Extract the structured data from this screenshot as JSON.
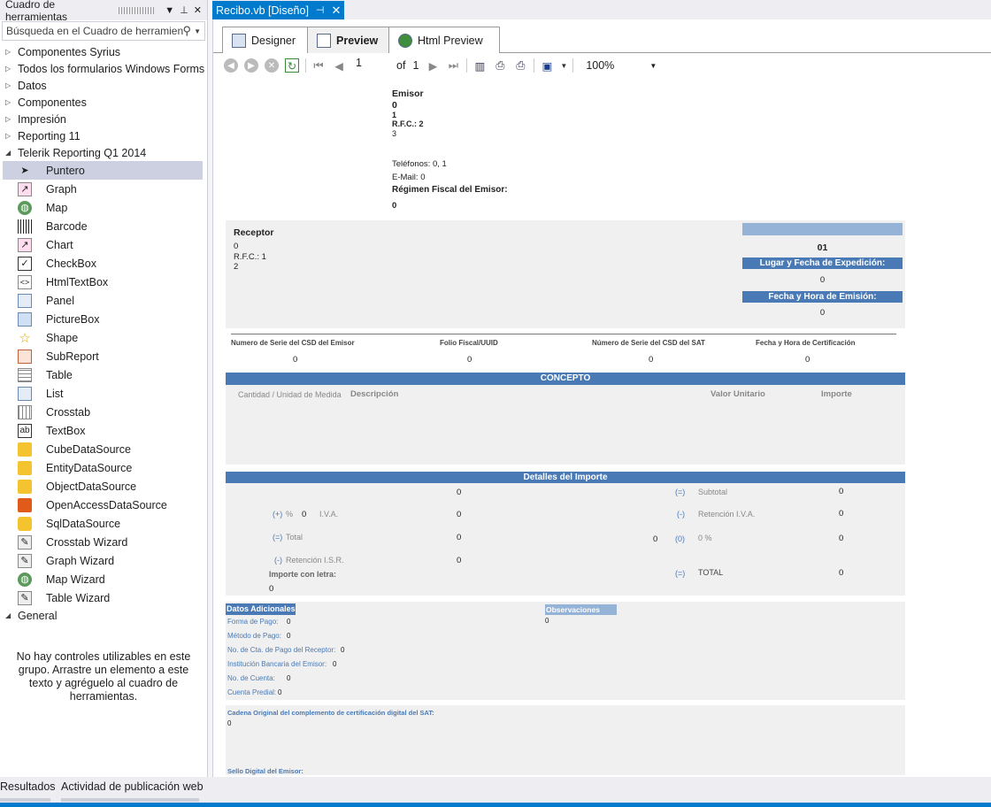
{
  "toolbox": {
    "title": "Cuadro de herramientas",
    "search_placeholder": "Búsqueda en el Cuadro de herramientas",
    "categories": [
      {
        "label": "Componentes Syrius"
      },
      {
        "label": "Todos los formularios Windows Forms"
      },
      {
        "label": "Datos"
      },
      {
        "label": "Componentes"
      },
      {
        "label": "Impresión"
      },
      {
        "label": "Reporting 11"
      },
      {
        "label": "Telerik Reporting Q1 2014"
      }
    ],
    "items": [
      {
        "label": "Puntero",
        "icon": "pointer-icon"
      },
      {
        "label": "Graph",
        "icon": "graph-icon"
      },
      {
        "label": "Map",
        "icon": "map-icon"
      },
      {
        "label": "Barcode",
        "icon": "barcode-icon"
      },
      {
        "label": "Chart",
        "icon": "chart-icon"
      },
      {
        "label": "CheckBox",
        "icon": "checkbox-icon"
      },
      {
        "label": "HtmlTextBox",
        "icon": "htmltextbox-icon"
      },
      {
        "label": "Panel",
        "icon": "panel-icon"
      },
      {
        "label": "PictureBox",
        "icon": "picturebox-icon"
      },
      {
        "label": "Shape",
        "icon": "shape-icon"
      },
      {
        "label": "SubReport",
        "icon": "subreport-icon"
      },
      {
        "label": "Table",
        "icon": "table-icon"
      },
      {
        "label": "List",
        "icon": "list-icon"
      },
      {
        "label": "Crosstab",
        "icon": "crosstab-icon"
      },
      {
        "label": "TextBox",
        "icon": "textbox-icon"
      },
      {
        "label": "CubeDataSource",
        "icon": "cube-datasource-icon"
      },
      {
        "label": "EntityDataSource",
        "icon": "entity-datasource-icon"
      },
      {
        "label": "ObjectDataSource",
        "icon": "object-datasource-icon"
      },
      {
        "label": "OpenAccessDataSource",
        "icon": "openaccess-datasource-icon"
      },
      {
        "label": "SqlDataSource",
        "icon": "sql-datasource-icon"
      },
      {
        "label": "Crosstab Wizard",
        "icon": "crosstab-wizard-icon"
      },
      {
        "label": "Graph Wizard",
        "icon": "graph-wizard-icon"
      },
      {
        "label": "Map Wizard",
        "icon": "map-wizard-icon"
      },
      {
        "label": "Table Wizard",
        "icon": "table-wizard-icon"
      }
    ],
    "general_label": "General",
    "empty_message": "No hay controles utilizables en este grupo. Arrastre un elemento a este texto y agréguelo al cuadro de herramientas."
  },
  "document": {
    "tab_title": "Recibo.vb [Diseño]",
    "view_tabs": [
      "Designer",
      "Preview",
      "Html Preview"
    ],
    "page_number": "1",
    "of_label": "of",
    "total_pages": "1",
    "zoom": "100%"
  },
  "report": {
    "emisor": {
      "title": "Emisor",
      "name": "0",
      "line1": "1",
      "rfc": "R.F.C.: 2",
      "line3": "3",
      "phones": "Teléfonos: 0, 1",
      "email": "E-Mail: 0",
      "regimen_label": "Régimen Fiscal del Emisor:",
      "regimen_value": "0"
    },
    "receptor": {
      "title": "Receptor",
      "name": "0",
      "rfc": "R.F.C.: 1",
      "line2": "2"
    },
    "right_box": {
      "folio": "01",
      "lugar_label": "Lugar y Fecha de Expedición:",
      "lugar_value": "0",
      "fecha_label": "Fecha y Hora de Emisión:",
      "fecha_value": "0"
    },
    "cert": {
      "headers": [
        "Numero de Serie del CSD del Emisor",
        "Folio Fiscal/UUID",
        "Número de Serie del CSD del SAT",
        "Fecha y Hora de Certificación"
      ],
      "values": [
        "0",
        "0",
        "0",
        "0"
      ]
    },
    "concepto": {
      "title": "CONCEPTO",
      "columns": [
        "Cantidad / Unidad de Medida",
        "Descripción",
        "Valor Unitario",
        "Importe"
      ]
    },
    "detalles": {
      "title": "Detalles del Importe",
      "top_value": "0",
      "iva_prefix": "(+)",
      "iva_pct_sign": "%",
      "iva_pct": "0",
      "iva_label": "I.V.A.",
      "iva_value": "0",
      "total_prefix": "(=)",
      "total_label": "Total",
      "total_value": "0",
      "ret_isr_prefix": "(-)",
      "ret_isr_label": "Retención I.S.R.",
      "ret_isr_value": "0",
      "importe_letra_label": "Importe con letra:",
      "importe_letra_value": "0",
      "subtotal_prefix": "(=)",
      "subtotal_label": "Subtotal",
      "subtotal_value": "0",
      "ret_iva_prefix": "(-)",
      "ret_iva_label": "Retención I.V.A.",
      "ret_iva_value": "0",
      "mid_value": "0",
      "pct_prefix": "(0)",
      "pct_label": "0 %",
      "pct_value": "0",
      "grand_prefix": "(=)",
      "grand_label": "TOTAL",
      "grand_value": "0"
    },
    "adicionales": {
      "title": "Datos Adicionales",
      "rows": [
        {
          "label": "Forma de Pago:",
          "value": "0"
        },
        {
          "label": "Método de Pago:",
          "value": "0"
        },
        {
          "label": "No. de Cta. de Pago del Receptor:",
          "value": "0"
        },
        {
          "label": "Institución Bancaria del Emisor:",
          "value": "0"
        },
        {
          "label": "No. de Cuenta:",
          "value": "0"
        },
        {
          "label": "Cuenta Predial:",
          "value": "0"
        }
      ],
      "obs_title": "Observaciones",
      "obs_value": "0"
    },
    "cadena_label": "Cadena Original del complemento de certificación digital del SAT:",
    "cadena_value": "0",
    "sello_label": "Sello Digital del Emisor:"
  },
  "bottom_tabs": [
    "Resultados",
    "Actividad de publicación web"
  ],
  "colors": {
    "accent": "#007acc",
    "report_header": "#4a7ab5"
  }
}
